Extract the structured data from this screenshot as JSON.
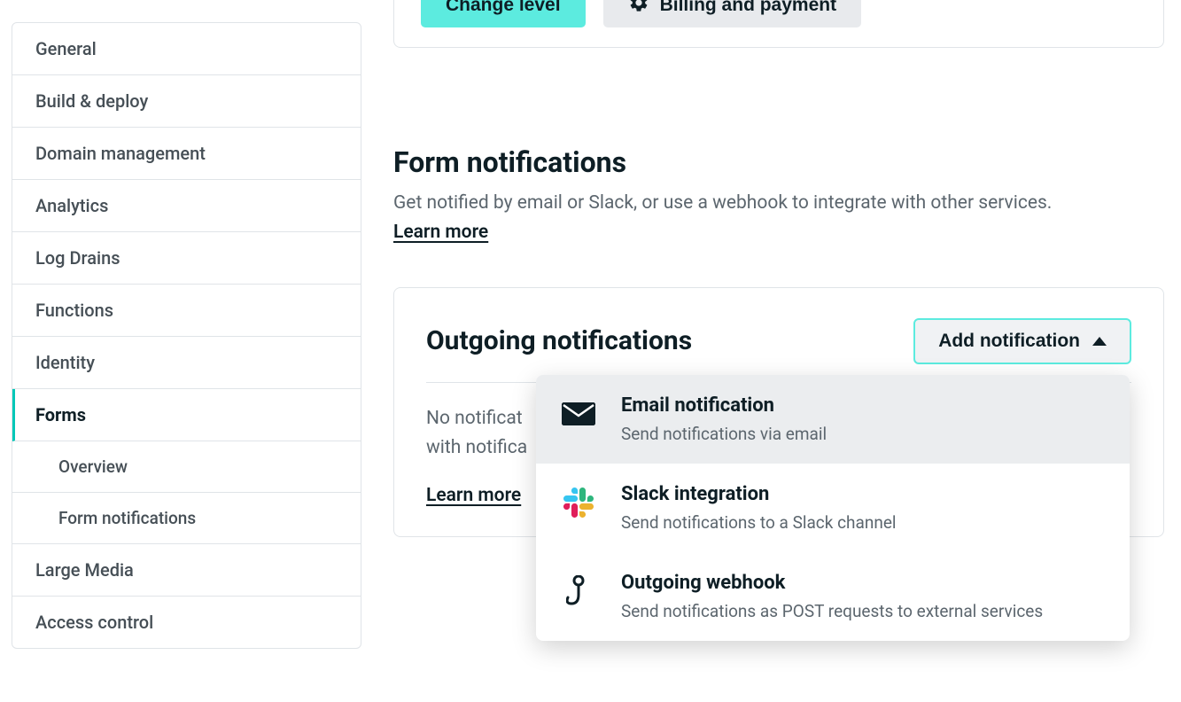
{
  "sidebar": {
    "items": [
      {
        "label": "General"
      },
      {
        "label": "Build & deploy"
      },
      {
        "label": "Domain management"
      },
      {
        "label": "Analytics"
      },
      {
        "label": "Log Drains"
      },
      {
        "label": "Functions"
      },
      {
        "label": "Identity"
      },
      {
        "label": "Forms",
        "active": true
      },
      {
        "label": "Large Media"
      },
      {
        "label": "Access control"
      }
    ],
    "subitems": [
      {
        "label": "Overview"
      },
      {
        "label": "Form notifications"
      }
    ]
  },
  "top_buttons": {
    "change_level": "Change level",
    "billing": "Billing and payment"
  },
  "section": {
    "title": "Form notifications",
    "description": "Get notified by email or Slack, or use a webhook to integrate with other services.",
    "learn_more": "Learn more"
  },
  "outgoing": {
    "title": "Outgoing notifications",
    "add_button": "Add notification",
    "empty_line1": "No notificat",
    "empty_line2": "with notifica",
    "learn_more": "Learn more"
  },
  "dropdown": {
    "items": [
      {
        "title": "Email notification",
        "subtitle": "Send notifications via email",
        "icon": "email"
      },
      {
        "title": "Slack integration",
        "subtitle": "Send notifications to a Slack channel",
        "icon": "slack"
      },
      {
        "title": "Outgoing webhook",
        "subtitle": "Send notifications as POST requests to external services",
        "icon": "webhook"
      }
    ]
  }
}
